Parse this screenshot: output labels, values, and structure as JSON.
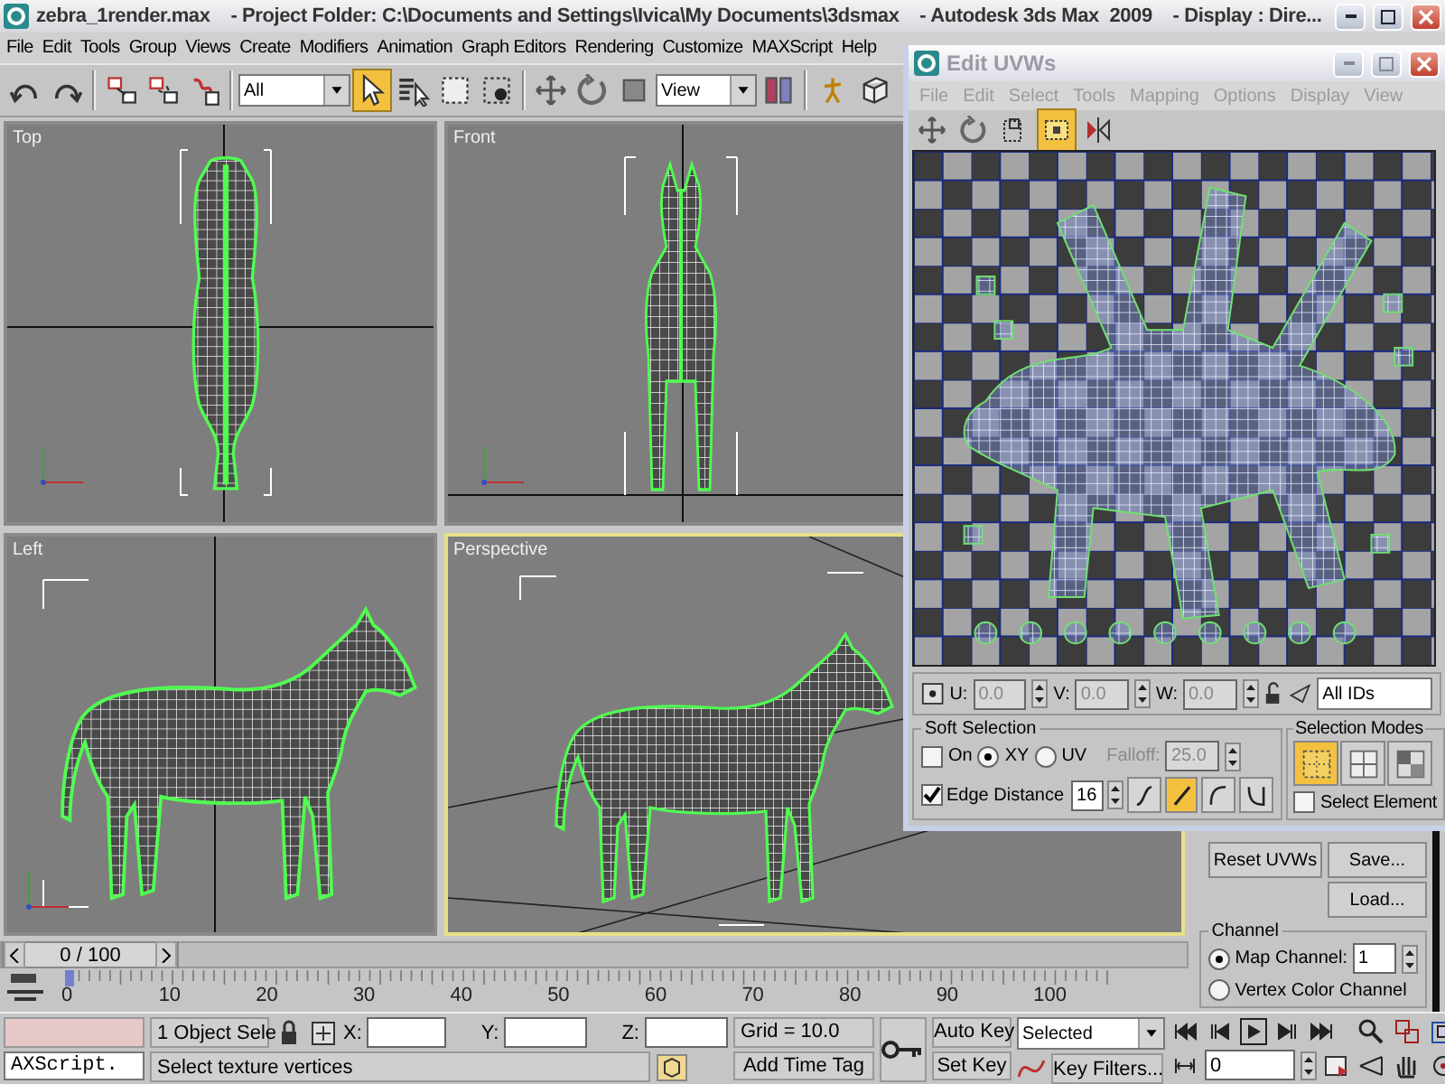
{
  "window": {
    "title": "zebra_1render.max    - Project Folder: C:\\Documents and Settings\\Ivica\\My Documents\\3dsmax    - Autodesk 3ds Max  2009    - Display : Dire..."
  },
  "menu": [
    "File",
    "Edit",
    "Tools",
    "Group",
    "Views",
    "Create",
    "Modifiers",
    "Animation",
    "Graph Editors",
    "Rendering",
    "Customize",
    "MAXScript",
    "Help"
  ],
  "toolbar": {
    "groups": [
      [
        {
          "kind": "undo",
          "selected": false
        },
        {
          "kind": "redo",
          "selected": false
        }
      ],
      [
        {
          "kind": "link",
          "selected": false
        },
        {
          "kind": "unlink",
          "selected": false
        },
        {
          "kind": "bind",
          "selected": false
        }
      ],
      [
        {
          "kind": "dropdown",
          "value": "All"
        },
        {
          "kind": "select",
          "selected": true
        },
        {
          "kind": "select-by-name",
          "selected": false
        },
        {
          "kind": "rect-region",
          "selected": false
        },
        {
          "kind": "window-crossing",
          "selected": false
        }
      ],
      [
        {
          "kind": "move",
          "selected": false
        },
        {
          "kind": "rotate",
          "selected": false
        },
        {
          "kind": "scale",
          "selected": false
        },
        {
          "kind": "dropdown",
          "value": "View"
        },
        {
          "kind": "pivot",
          "selected": false
        }
      ],
      [
        {
          "kind": "manipulate",
          "selected": false
        },
        {
          "kind": "cube",
          "selected": false
        }
      ]
    ]
  },
  "viewports": [
    {
      "label": "Top",
      "kind": "top",
      "active": false
    },
    {
      "label": "Front",
      "kind": "front",
      "active": false
    },
    {
      "label": "Left",
      "kind": "side",
      "active": false
    },
    {
      "label": "Perspective",
      "kind": "perspective",
      "active": true
    }
  ],
  "uvw_window": {
    "title": "Edit UVWs",
    "menu": [
      "File",
      "Edit",
      "Select",
      "Tools",
      "Mapping",
      "Options",
      "Display",
      "View"
    ],
    "toolbar": [
      {
        "kind": "move",
        "selected": false
      },
      {
        "kind": "rotate",
        "selected": false
      },
      {
        "kind": "scale-dotted",
        "selected": false
      },
      {
        "kind": "freeform",
        "selected": true
      },
      {
        "kind": "mirror",
        "selected": false
      }
    ],
    "coords": [
      {
        "label": "U:",
        "value": "0.0",
        "disabled": true
      },
      {
        "label": "V:",
        "value": "0.0",
        "disabled": true
      },
      {
        "label": "W:",
        "value": "0.0",
        "disabled": true
      }
    ],
    "id_filter": "All IDs",
    "soft_selection": {
      "title": "Soft Selection",
      "on": {
        "label": "On",
        "checked": false
      },
      "spaces": [
        {
          "label": "XY",
          "selected": true
        },
        {
          "label": "UV",
          "selected": false
        }
      ],
      "falloff": {
        "label": "Falloff:",
        "value": "25.0",
        "disabled": true
      },
      "edge_distance": {
        "label": "Edge Distance",
        "checked": true,
        "value": "16"
      },
      "curves": [
        {
          "kind": "smooth",
          "selected": false
        },
        {
          "kind": "linear",
          "selected": true
        },
        {
          "kind": "slow-out",
          "selected": false
        },
        {
          "kind": "fast-out",
          "selected": false
        }
      ]
    },
    "selection_modes": {
      "title": "Selection Modes",
      "modes": [
        {
          "kind": "vertex",
          "selected": true
        },
        {
          "kind": "edge",
          "selected": false
        },
        {
          "kind": "face",
          "selected": false
        }
      ],
      "select_element": {
        "label": "Select Element",
        "checked": false
      }
    }
  },
  "command_panel": {
    "buttons": [
      "Reset UVWs",
      "Save...",
      "Load..."
    ],
    "channel": {
      "title": "Channel",
      "options": [
        {
          "label": "Map Channel:",
          "selected": true,
          "value": "1"
        },
        {
          "label": "Vertex Color Channel",
          "selected": false
        }
      ]
    }
  },
  "time_slider": {
    "label": "0 / 100",
    "level": 0
  },
  "track_bar": {
    "ticks": [
      "0",
      "10",
      "20",
      "30",
      "40",
      "50",
      "60",
      "70",
      "80",
      "90",
      "100"
    ]
  },
  "status": {
    "maxscript": "AXScript.",
    "selection": "1 Object Sele",
    "coords": [
      "X:",
      "Y:",
      "Z:"
    ],
    "grid": "Grid = 10.0",
    "prompt": "Select texture vertices",
    "time_tag": "Add Time Tag",
    "auto_key": "Auto Key",
    "set_key": "Set Key",
    "key_mode": "Selected",
    "key_filters": "Key Filters...",
    "frame": "0"
  }
}
